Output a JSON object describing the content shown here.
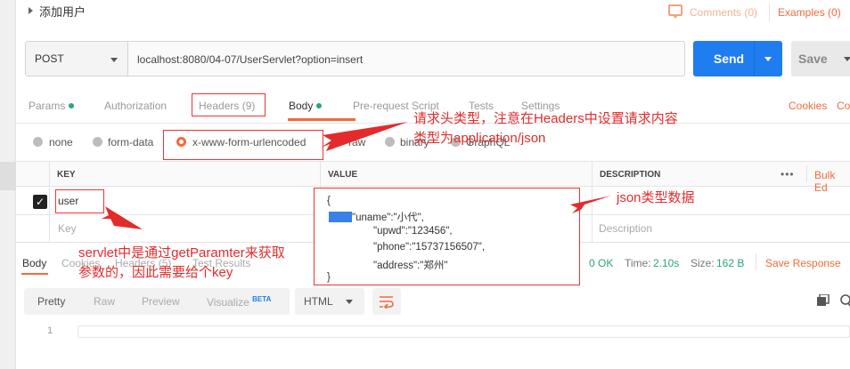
{
  "request": {
    "title": "添加用户",
    "comments": "Comments (0)",
    "examples": "Examples (0)",
    "method": "POST",
    "url": "localhost:8080/04-07/UserServlet?option=insert",
    "send": "Send",
    "save": "Save"
  },
  "tabs": {
    "params": "Params",
    "authorization": "Authorization",
    "headers": "Headers (9)",
    "body": "Body",
    "prerequest": "Pre-request Script",
    "tests": "Tests",
    "settings": "Settings",
    "cookies": "Cookies",
    "code": "Co"
  },
  "body_types": {
    "none": "none",
    "form_data": "form-data",
    "urlencoded": "x-www-form-urlencoded",
    "raw": "raw",
    "binary": "binary",
    "graphql": "GraphQL"
  },
  "grid": {
    "col_key": "KEY",
    "col_value": "VALUE",
    "col_description": "DESCRIPTION",
    "more": "•••",
    "bulk_edit": "Bulk Ed",
    "row_key": "user",
    "key_placeholder": "Key",
    "description_placeholder": "Description"
  },
  "json_value": {
    "open": "{",
    "line1": "\"uname\":\"小代\",",
    "line2": "\"upwd\":\"123456\",",
    "line3": "\"phone\":\"15737156507\",",
    "line4": "\"address\":\"郑州\"",
    "close": "}"
  },
  "response": {
    "body": "Body",
    "cookies": "Cookies",
    "headers": "Headers (5)",
    "test_results": "Test Results",
    "status": "0 OK",
    "time_label": "Time:",
    "time": "2.10s",
    "size_label": "Size:",
    "size": "162 B",
    "save_response": "Save Response",
    "pretty": "Pretty",
    "raw": "Raw",
    "preview": "Preview",
    "visualize": "Visualize",
    "beta": "BETA",
    "format": "HTML",
    "line_no": "1"
  },
  "annotations": {
    "headers_note_1": "请求头类型，注意在Headers中设置请求内容",
    "headers_note_2": "类型为application/json",
    "json_note": "json类型数据",
    "servlet_note_1": "servlet中是通过getParamter来获取",
    "servlet_note_2": "参数的，因此需要给个key"
  },
  "colors": {
    "accent": "#f26b3a",
    "send_blue": "#1f7df0",
    "annotation_red": "#e32b2b",
    "status_green": "#2aa772"
  }
}
